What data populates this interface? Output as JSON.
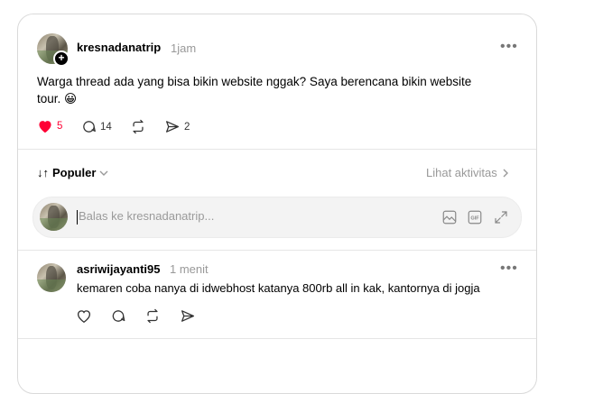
{
  "post": {
    "username": "kresnadanatrip",
    "time": "1jam",
    "text": "Warga thread ada yang bisa bikin website nggak? Saya berencana bikin website tour. 😀",
    "likes": "5",
    "replies": "14",
    "shares": "2",
    "follow_glyph": "+",
    "more_glyph": "•••"
  },
  "sort": {
    "label": "Populer"
  },
  "activity": {
    "label": "Lihat aktivitas"
  },
  "reply": {
    "placeholder": "Balas ke kresnadanatrip..."
  },
  "comment": {
    "username": "asriwijayanti95",
    "time": "1 menit",
    "text": "kemaren coba nanya di idwebhost katanya 800rb all in kak, kantornya di jogja",
    "more_glyph": "•••"
  },
  "colors": {
    "like_active": "#ff0034",
    "muted": "#999999",
    "border": "#dadada"
  }
}
